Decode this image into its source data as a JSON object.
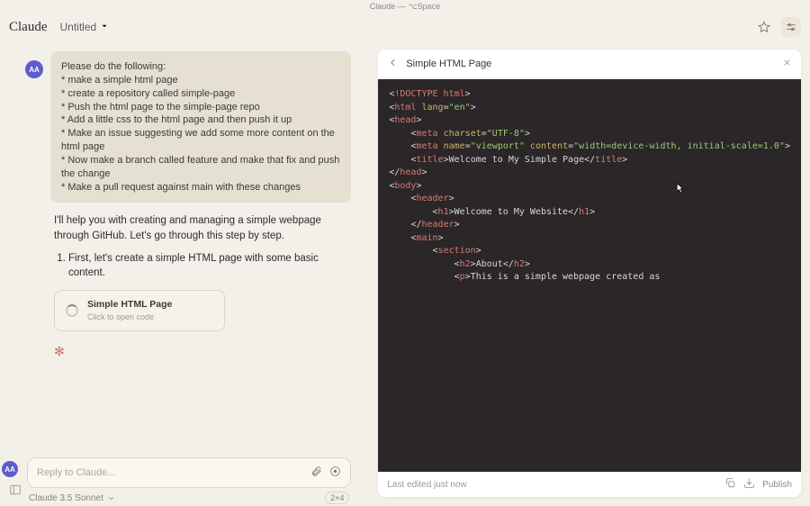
{
  "titlebar": "Claude — ⌥Space",
  "header": {
    "logo": "Claude",
    "doc_title": "Untitled"
  },
  "user_message": {
    "avatar": "AA",
    "intro": "Please do the following:",
    "steps": [
      "make a simple html page",
      "create a repository called simple-page",
      "Push the html page to the simple-page repo",
      "Add a little css to the html page and then push it up",
      "Make an issue suggesting we add some more content on the html page",
      "Now make a branch called feature and make that fix and push the change",
      "Make a pull request against main with these changes"
    ]
  },
  "assistant": {
    "line1": "I'll help you with creating and managing a simple webpage through GitHub. Let's go through this step by step.",
    "ol_item1": "First, let's create a simple HTML page with some basic content."
  },
  "artifact_card": {
    "title": "Simple HTML Page",
    "sub": "Click to open code"
  },
  "composer": {
    "placeholder": "Reply to Claude...",
    "model": "Claude 3.5 Sonnet",
    "badge": "2×4"
  },
  "panel": {
    "title": "Simple HTML Page",
    "footer_status": "Last edited just now",
    "publish": "Publish"
  },
  "code": {
    "l1_doctype": "!DOCTYPE html",
    "l2_html": "html",
    "l2_lang_attr": "lang",
    "l2_lang_val": "\"en\"",
    "l3_head": "head",
    "l4_meta": "meta",
    "l4_charset_attr": "charset",
    "l4_charset_val": "\"UTF-8\"",
    "l5_meta": "meta",
    "l5_name_attr": "name",
    "l5_name_val": "\"viewport\"",
    "l5_content_attr": "content",
    "l5_content_val": "\"width=device-width, initial-scale=1.0\"",
    "l6_title": "title",
    "l6_title_text": "Welcome to My Simple Page",
    "l7_head_close": "head",
    "l8_body": "body",
    "l9_header": "header",
    "l10_h1": "h1",
    "l10_h1_text": "Welcome to My Website",
    "l11_header_close": "header",
    "l12_main": "main",
    "l13_section": "section",
    "l14_h2": "h2",
    "l14_h2_text": "About",
    "l15_p": "p",
    "l15_p_text": "This is a simple webpage created as"
  }
}
